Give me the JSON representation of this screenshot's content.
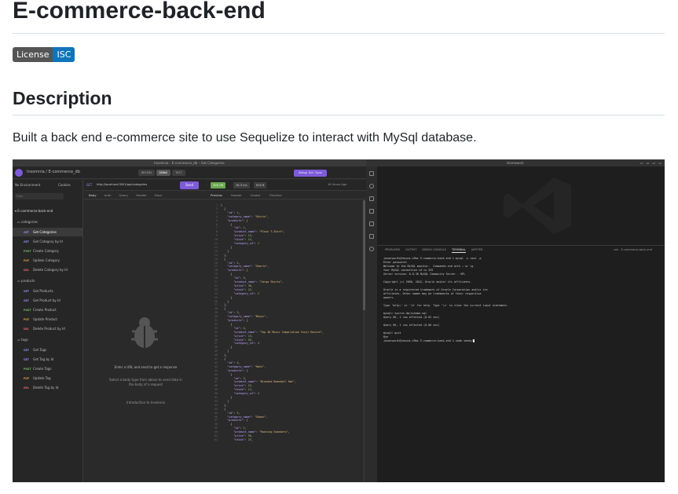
{
  "readme": {
    "title": "E-commerce-back-end",
    "badge": {
      "left": "License",
      "right": "ISC"
    },
    "description_heading": "Description",
    "description_text": "Built a back end e-commerce site to use Sequelize to interact with MySql database."
  },
  "insomnia": {
    "window_title": "Insomnia – E-commerce_db – Get Categories",
    "breadcrumb": "Insomnia / E-commerce_db",
    "modes": [
      "DESIGN",
      "DEBUG",
      "TEST"
    ],
    "sync_button": "Setup Git Sync",
    "environment": "No Environment",
    "cookies": "Cookies",
    "filter_placeholder": "Filter",
    "collection": "E-commerce-back-end",
    "folders": [
      {
        "name": "categories",
        "requests": [
          {
            "method": "GET",
            "name": "Get Categories",
            "selected": true
          },
          {
            "method": "GET",
            "name": "Get Category by Id"
          },
          {
            "method": "POST",
            "name": "Create Category"
          },
          {
            "method": "PUT",
            "name": "Update Category"
          },
          {
            "method": "DEL",
            "name": "Delete Category by Id"
          }
        ]
      },
      {
        "name": "products",
        "requests": [
          {
            "method": "GET",
            "name": "Get Products"
          },
          {
            "method": "GET",
            "name": "Get Product by Id"
          },
          {
            "method": "POST",
            "name": "Create Product"
          },
          {
            "method": "PUT",
            "name": "Update Product"
          },
          {
            "method": "DEL",
            "name": "Delete Product by Id"
          }
        ]
      },
      {
        "name": "tags",
        "requests": [
          {
            "method": "GET",
            "name": "Get Tags"
          },
          {
            "method": "GET",
            "name": "Get Tag by Id"
          },
          {
            "method": "POST",
            "name": "Create Tags"
          },
          {
            "method": "PUT",
            "name": "Update Tag"
          },
          {
            "method": "DEL",
            "name": "Delete Tag by Id"
          }
        ]
      }
    ],
    "request": {
      "method": "GET",
      "url": "http://localhost:3001/api/categories",
      "send": "Send",
      "tabs": [
        "Body",
        "Auth",
        "Query",
        "Header",
        "Docs"
      ],
      "empty_title": "Enter a URL and send to get a response",
      "empty_hint": "Select a body type from above to send data in the body of a request",
      "intro_link": "Introduction to Insomnia"
    },
    "response": {
      "status": "200 OK",
      "time": "28.3 ms",
      "size": "635 B",
      "ago": "18 Hours Ago",
      "tabs": [
        "Preview",
        "Header",
        "Cookie",
        "Timeline"
      ],
      "json_lines": [
        "[",
        "  {",
        "    \"id\": 1,",
        "    \"category_name\": \"Shirts\",",
        "    \"products\": [",
        "      {",
        "        \"id\": 1,",
        "        \"product_name\": \"Plain T-Shirt\",",
        "        \"price\": 15,",
        "        \"stock\": 14,",
        "        \"category_id\": 1",
        "      }",
        "    ]",
        "  },",
        "  {",
        "    \"id\": 2,",
        "    \"category_name\": \"Shorts\",",
        "    \"products\": [",
        "      {",
        "        \"id\": 5,",
        "        \"product_name\": \"Cargo Shorts\",",
        "        \"price\": 30,",
        "        \"stock\": 22,",
        "        \"category_id\": 2",
        "      }",
        "    ]",
        "  },",
        "  {",
        "    \"id\": 3,",
        "    \"category_name\": \"Music\",",
        "    \"products\": [",
        "      {",
        "        \"id\": 4,",
        "        \"product_name\": \"Top 40 Music Compilation Vinyl Record\",",
        "        \"price\": 13,",
        "        \"stock\": 50,",
        "        \"category_id\": 3",
        "      }",
        "    ]",
        "  },",
        "  {",
        "    \"id\": 4,",
        "    \"category_name\": \"Hats\",",
        "    \"products\": [",
        "      {",
        "        \"id\": 3,",
        "        \"product_name\": \"Branded Baseball Hat\",",
        "        \"price\": 22,",
        "        \"stock\": 12,",
        "        \"category_id\": 4",
        "      }",
        "    ]",
        "  },",
        "  {",
        "    \"id\": 5,",
        "    \"category_name\": \"Shoes\",",
        "    \"products\": [",
        "      {",
        "        \"id\": 2,",
        "        \"product_name\": \"Running Sneakers\",",
        "        \"price\": 90,",
        "        \"stock\": 25,"
      ]
    }
  },
  "vscode": {
    "window_title": "Homework",
    "panel_tabs": [
      "PROBLEMS",
      "OUTPUT",
      "DEBUG CONSOLE",
      "TERMINAL",
      "JUPYTER"
    ],
    "active_panel_tab": "TERMINAL",
    "terminal_name": "zsh - E-commerce-back-end",
    "terminal_lines": [
      "jasonsouth@Jasons-iMac E-commerce-back-end % mysql -u root -p",
      "Enter password:",
      "Welcome to the MySQL monitor.  Commands end with ; or \\g.",
      "Your MySQL connection id is 335",
      "Server version: 8.0.30 MySQL Community Server - GPL",
      "",
      "Copyright (c) 2000, 2022, Oracle and/or its affiliates.",
      "",
      "Oracle is a registered trademark of Oracle Corporation and/or its",
      "affiliates. Other names may be trademarks of their respective",
      "owners.",
      "",
      "Type 'help;' or '\\h' for help. Type '\\c' to clear the current input statement.",
      "",
      "mysql> source db/schema.sql",
      "Query OK, 1 row affected (0.02 sec)",
      "",
      "Query OK, 1 row affected (0.00 sec)",
      "",
      "mysql> quit",
      "Bye",
      "jasonsouth@Jasons-iMac E-commerce-back-end % node seeds/"
    ]
  },
  "colors": {
    "accent": "#7e5bd9",
    "badge_right": "#0d75b8",
    "status_ok": "#6aa84f"
  }
}
